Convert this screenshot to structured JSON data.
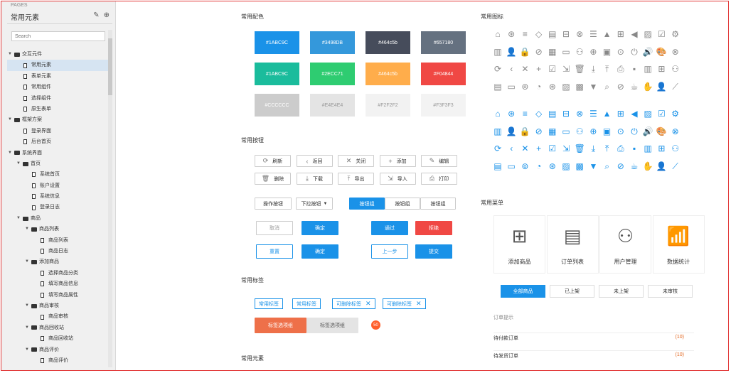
{
  "sidebar": {
    "pages_label": "PAGES",
    "title": "常用元素",
    "search_placeholder": "Search",
    "tree": [
      {
        "label": "交互元件",
        "level": 0,
        "type": "folder",
        "expanded": true
      },
      {
        "label": "常用元素",
        "level": 1,
        "type": "doc",
        "selected": true
      },
      {
        "label": "表单元素",
        "level": 1,
        "type": "doc"
      },
      {
        "label": "常用组件",
        "level": 1,
        "type": "doc"
      },
      {
        "label": "选择组件",
        "level": 1,
        "type": "doc"
      },
      {
        "label": "原生表单",
        "level": 1,
        "type": "doc"
      },
      {
        "label": "框架方案",
        "level": 0,
        "type": "folder",
        "expanded": true
      },
      {
        "label": "登录界面",
        "level": 1,
        "type": "doc"
      },
      {
        "label": "后台首页",
        "level": 1,
        "type": "doc"
      },
      {
        "label": "系统界面",
        "level": 0,
        "type": "folder",
        "expanded": true
      },
      {
        "label": "首页",
        "level": 1,
        "type": "folder",
        "expanded": true
      },
      {
        "label": "系统首页",
        "level": 2,
        "type": "doc"
      },
      {
        "label": "账户设置",
        "level": 2,
        "type": "doc"
      },
      {
        "label": "系统信息",
        "level": 2,
        "type": "doc"
      },
      {
        "label": "登录日志",
        "level": 2,
        "type": "doc"
      },
      {
        "label": "商品",
        "level": 1,
        "type": "folder",
        "expanded": true
      },
      {
        "label": "商品列表",
        "level": 2,
        "type": "folder",
        "expanded": true
      },
      {
        "label": "商品列表",
        "level": 3,
        "type": "doc"
      },
      {
        "label": "商品日志",
        "level": 3,
        "type": "doc"
      },
      {
        "label": "添加商品",
        "level": 2,
        "type": "folder",
        "expanded": true
      },
      {
        "label": "选择商品分类",
        "level": 3,
        "type": "doc"
      },
      {
        "label": "填写商品信息",
        "level": 3,
        "type": "doc"
      },
      {
        "label": "填写商品属性",
        "level": 3,
        "type": "doc"
      },
      {
        "label": "商品审核",
        "level": 2,
        "type": "folder",
        "expanded": true
      },
      {
        "label": "商品审核",
        "level": 3,
        "type": "doc"
      },
      {
        "label": "商品回收站",
        "level": 2,
        "type": "folder",
        "expanded": true
      },
      {
        "label": "商品回收站",
        "level": 3,
        "type": "doc"
      },
      {
        "label": "商品评价",
        "level": 2,
        "type": "folder",
        "expanded": true
      },
      {
        "label": "商品评价",
        "level": 3,
        "type": "doc"
      }
    ]
  },
  "colors": {
    "title": "常用配色",
    "swatches": [
      {
        "label": "#1ABC9C",
        "bg": "#1a92e8",
        "fg": "#ffffff"
      },
      {
        "label": "#3498DB",
        "bg": "#3498db",
        "fg": "#ffffff"
      },
      {
        "label": "#464c5b",
        "bg": "#464c5b",
        "fg": "#ffffff"
      },
      {
        "label": "#657180",
        "bg": "#657180",
        "fg": "#ffffff"
      },
      {
        "label": "#1ABC9C",
        "bg": "#1abc9c",
        "fg": "#ffffff"
      },
      {
        "label": "#2ECC71",
        "bg": "#2ecc71",
        "fg": "#ffffff"
      },
      {
        "label": "#464c5b",
        "bg": "#ffad4b",
        "fg": "#ffffff"
      },
      {
        "label": "#F04844",
        "bg": "#f04844",
        "fg": "#ffffff"
      },
      {
        "label": "#CCCCCC",
        "bg": "#cccccc",
        "fg": "#ffffff"
      },
      {
        "label": "#E4E4E4",
        "bg": "#e4e4e4",
        "fg": "#999999"
      },
      {
        "label": "#F2F2F2",
        "bg": "#f2f2f2",
        "fg": "#999999"
      },
      {
        "label": "#F3F3F3",
        "bg": "#f3f3f3",
        "fg": "#999999"
      }
    ]
  },
  "buttons": {
    "title": "常用按钮",
    "icon_buttons": [
      {
        "label": "刷新",
        "icon": "refresh-icon",
        "glyph": "⟳"
      },
      {
        "label": "返回",
        "icon": "back-icon",
        "glyph": "‹"
      },
      {
        "label": "关闭",
        "icon": "close-icon",
        "glyph": "✕"
      },
      {
        "label": "添加",
        "icon": "add-icon",
        "glyph": "+"
      },
      {
        "label": "编辑",
        "icon": "edit-icon",
        "glyph": "✎"
      },
      {
        "label": "删除",
        "icon": "delete-icon",
        "glyph": "🗑"
      },
      {
        "label": "下载",
        "icon": "download-icon",
        "glyph": "⤓"
      },
      {
        "label": "导出",
        "icon": "export-icon",
        "glyph": "⤒"
      },
      {
        "label": "导入",
        "icon": "import-icon",
        "glyph": "⇲"
      },
      {
        "label": "打印",
        "icon": "print-icon",
        "glyph": "⎙"
      }
    ],
    "action_button": "操作按钮",
    "dropdown_button": "下拉按钮",
    "button_group": [
      "按钮组",
      "按钮组",
      "按钮组"
    ],
    "cancel": "取消",
    "confirm": "确定",
    "pass": "通过",
    "reject": "拒绝",
    "reset": "重置",
    "confirm2": "确定",
    "prev": "上一步",
    "submit": "提交"
  },
  "tags": {
    "title": "常用标签",
    "items": [
      "常用标签",
      "常用标签",
      "可删除标签",
      "可删除标签"
    ],
    "tab_active": "标签选项组",
    "tab_inactive": "标签选项组",
    "badge": "50"
  },
  "elements": {
    "title": "常用元素"
  },
  "icons": {
    "title": "常用图标",
    "row_glyphs": [
      [
        "⌂",
        "⊛",
        "≡",
        "◇",
        "▤",
        "⊟",
        "⊗",
        "☰",
        "▲",
        "⊞",
        "◀",
        "▨",
        "☑",
        "⚙"
      ],
      [
        "▥",
        "👤",
        "🔒",
        "⊘",
        "▦",
        "▭",
        "⚇",
        "⊕",
        "▣",
        "⊙",
        "⏻",
        "🔊",
        "🎨",
        "⊗"
      ],
      [
        "⟳",
        "‹",
        "✕",
        "+",
        "☑",
        "⇲",
        "🗑",
        "⤓",
        "⤒",
        "⎙",
        "▪",
        "▥",
        "⊞",
        "⚇"
      ],
      [
        "▤",
        "▭",
        "⊚",
        "◔",
        "⊛",
        "▨",
        "▩",
        "▼",
        "⌕",
        "⊘",
        "☕",
        "✋",
        "👤",
        "⟋"
      ]
    ],
    "gray_color": "#888888",
    "blue_color": "#1a92e8"
  },
  "menu": {
    "title": "常用菜单",
    "cards": [
      {
        "label": "添加商品",
        "icon": "add-box-icon",
        "glyph": "⊞"
      },
      {
        "label": "订单列表",
        "icon": "clipboard-icon",
        "glyph": "▤"
      },
      {
        "label": "用户管理",
        "icon": "user-settings-icon",
        "glyph": "⚇"
      },
      {
        "label": "数据统计",
        "icon": "bar-chart-icon",
        "glyph": "📶"
      }
    ]
  },
  "goods_tabs": [
    "全部商品",
    "已上架",
    "未上架",
    "未审核"
  ],
  "orders": {
    "header": "订单提示",
    "rows": [
      {
        "label": "待付款订单",
        "count": "(10)"
      },
      {
        "label": "待发货订单",
        "count": "(10)"
      }
    ]
  }
}
